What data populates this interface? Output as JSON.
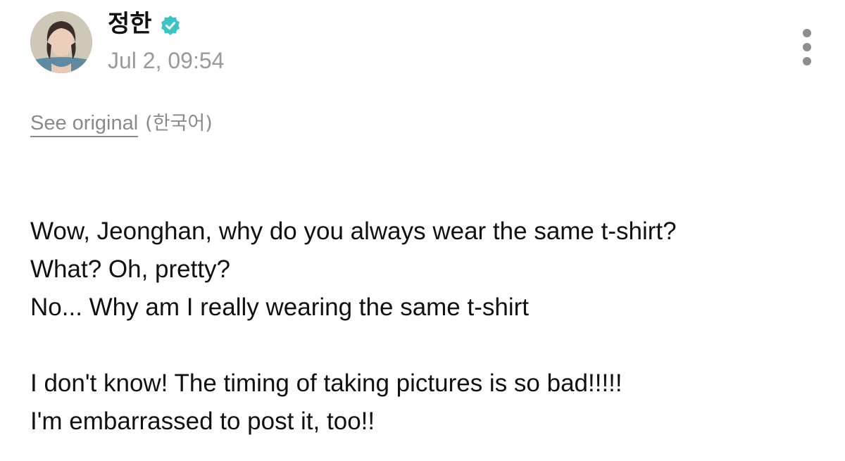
{
  "author": {
    "name": "정한",
    "verified": true,
    "time": "Jul 2, 09:54"
  },
  "icons": {
    "avatar": "profile-photo",
    "verified": "verified-badge-icon",
    "more": "more-vertical-icon"
  },
  "colors": {
    "verified_badge": "#3cc3c8",
    "secondary_text": "#8a8a8a",
    "body_text": "#111111"
  },
  "translation": {
    "see_original_label": "See original",
    "language_note": "(한국어)"
  },
  "body": {
    "lines": [
      "Wow, Jeonghan, why do you always wear the same t-shirt?",
      "What? Oh, pretty?",
      "No... Why am I really wearing the same t-shirt",
      "",
      "I don't know! The timing of taking pictures is so bad!!!!!",
      "I'm embarrassed to post it, too!!"
    ]
  }
}
